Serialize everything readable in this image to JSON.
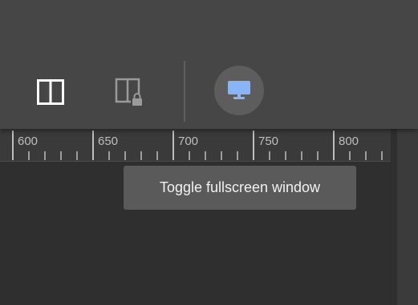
{
  "toolbar": {
    "icons": [
      "split-view-icon",
      "locked-split-view-icon",
      "monitor-icon"
    ],
    "accent_color": "#8ab4f8"
  },
  "ruler": {
    "labels": [
      "600",
      "650",
      "700",
      "750",
      "800"
    ]
  },
  "tooltip": {
    "text": "Toggle fullscreen window"
  }
}
